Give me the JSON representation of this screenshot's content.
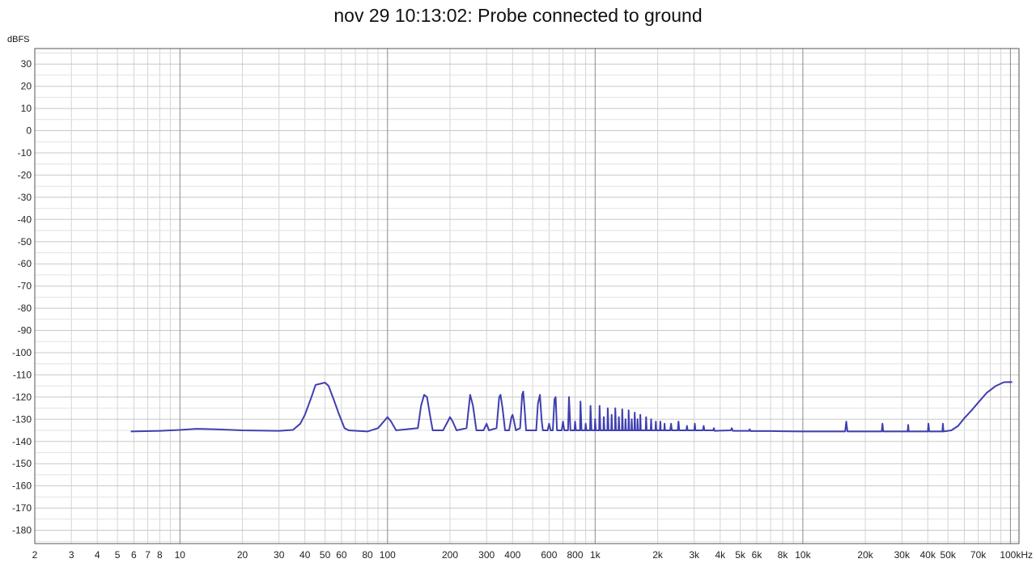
{
  "chart_data": {
    "type": "line",
    "title": "nov 29 10:13:02: Probe connected to ground",
    "ylabel": "dBFS",
    "xlabel": "",
    "x_scale": "log",
    "xlim": [
      2,
      110000
    ],
    "ylim": [
      -186,
      37
    ],
    "grid": true,
    "x_tick_labels": [
      {
        "v": 2,
        "t": "2"
      },
      {
        "v": 3,
        "t": "3"
      },
      {
        "v": 4,
        "t": "4"
      },
      {
        "v": 5,
        "t": "5"
      },
      {
        "v": 6,
        "t": "6"
      },
      {
        "v": 7,
        "t": "7"
      },
      {
        "v": 8,
        "t": "8"
      },
      {
        "v": 10,
        "t": "10"
      },
      {
        "v": 20,
        "t": "20"
      },
      {
        "v": 30,
        "t": "30"
      },
      {
        "v": 40,
        "t": "40"
      },
      {
        "v": 50,
        "t": "50"
      },
      {
        "v": 60,
        "t": "60"
      },
      {
        "v": 80,
        "t": "80"
      },
      {
        "v": 100,
        "t": "100"
      },
      {
        "v": 200,
        "t": "200"
      },
      {
        "v": 300,
        "t": "300"
      },
      {
        "v": 400,
        "t": "400"
      },
      {
        "v": 600,
        "t": "600"
      },
      {
        "v": 800,
        "t": "800"
      },
      {
        "v": 1000,
        "t": "1k"
      },
      {
        "v": 2000,
        "t": "2k"
      },
      {
        "v": 3000,
        "t": "3k"
      },
      {
        "v": 4000,
        "t": "4k"
      },
      {
        "v": 5000,
        "t": "5k"
      },
      {
        "v": 6000,
        "t": "6k"
      },
      {
        "v": 8000,
        "t": "8k"
      },
      {
        "v": 10000,
        "t": "10k"
      },
      {
        "v": 20000,
        "t": "20k"
      },
      {
        "v": 30000,
        "t": "30k"
      },
      {
        "v": 40000,
        "t": "40k"
      },
      {
        "v": 50000,
        "t": "50k"
      },
      {
        "v": 70000,
        "t": "70k"
      },
      {
        "v": 100000,
        "t": "100kHz"
      }
    ],
    "y_ticks": [
      30,
      20,
      10,
      0,
      -10,
      -20,
      -30,
      -40,
      -50,
      -60,
      -70,
      -80,
      -90,
      -100,
      -110,
      -120,
      -130,
      -140,
      -150,
      -160,
      -170,
      -180
    ],
    "series": [
      {
        "color": "#3f3fb0",
        "points": [
          [
            5.8,
            -135.5
          ],
          [
            8,
            -135.2
          ],
          [
            10,
            -134.8
          ],
          [
            12,
            -134.3
          ],
          [
            15,
            -134.5
          ],
          [
            20,
            -135
          ],
          [
            30,
            -135.2
          ],
          [
            35,
            -134.8
          ],
          [
            38,
            -132
          ],
          [
            40,
            -128
          ],
          [
            43,
            -120
          ],
          [
            45,
            -114.5
          ],
          [
            50,
            -113.5
          ],
          [
            52,
            -115
          ],
          [
            55,
            -121
          ],
          [
            58,
            -127
          ],
          [
            62,
            -134
          ],
          [
            65,
            -135
          ],
          [
            80,
            -135.5
          ],
          [
            90,
            -134
          ],
          [
            100,
            -129
          ],
          [
            104,
            -131
          ],
          [
            110,
            -135
          ],
          [
            140,
            -134
          ],
          [
            145,
            -124
          ],
          [
            150,
            -119
          ],
          [
            155,
            -120
          ],
          [
            160,
            -128
          ],
          [
            165,
            -135
          ],
          [
            185,
            -135
          ],
          [
            195,
            -131
          ],
          [
            200,
            -129
          ],
          [
            206,
            -131
          ],
          [
            215,
            -135
          ],
          [
            240,
            -134
          ],
          [
            250,
            -119
          ],
          [
            258,
            -124
          ],
          [
            268,
            -135
          ],
          [
            290,
            -135
          ],
          [
            300,
            -132
          ],
          [
            308,
            -135
          ],
          [
            335,
            -134
          ],
          [
            345,
            -120
          ],
          [
            350,
            -119
          ],
          [
            358,
            -125
          ],
          [
            368,
            -135
          ],
          [
            385,
            -135
          ],
          [
            395,
            -129
          ],
          [
            400,
            -128
          ],
          [
            405,
            -130
          ],
          [
            415,
            -135
          ],
          [
            435,
            -134
          ],
          [
            445,
            -119
          ],
          [
            450,
            -117.5
          ],
          [
            456,
            -124
          ],
          [
            465,
            -135
          ],
          [
            520,
            -135
          ],
          [
            530,
            -123
          ],
          [
            542,
            -119
          ],
          [
            552,
            -130
          ],
          [
            560,
            -135
          ],
          [
            590,
            -135
          ],
          [
            600,
            -132
          ],
          [
            610,
            -135
          ],
          [
            625,
            -135
          ],
          [
            637,
            -121
          ],
          [
            645,
            -120
          ],
          [
            655,
            -135
          ],
          [
            690,
            -135
          ],
          [
            700,
            -131
          ],
          [
            710,
            -135
          ],
          [
            740,
            -135
          ],
          [
            748,
            -120
          ],
          [
            760,
            -135
          ],
          [
            795,
            -135
          ],
          [
            800,
            -131
          ],
          [
            808,
            -135
          ],
          [
            845,
            -135
          ],
          [
            850,
            -122
          ],
          [
            860,
            -135
          ],
          [
            895,
            -135
          ],
          [
            900,
            -132
          ],
          [
            908,
            -135
          ],
          [
            945,
            -135
          ],
          [
            950,
            -124
          ],
          [
            960,
            -135
          ],
          [
            995,
            -135
          ],
          [
            1000,
            -130
          ],
          [
            1008,
            -135
          ],
          [
            1045,
            -135
          ],
          [
            1050,
            -124
          ],
          [
            1060,
            -135
          ],
          [
            1095,
            -135
          ],
          [
            1100,
            -129
          ],
          [
            1108,
            -135
          ],
          [
            1145,
            -135
          ],
          [
            1150,
            -125
          ],
          [
            1160,
            -135
          ],
          [
            1195,
            -135
          ],
          [
            1200,
            -128
          ],
          [
            1208,
            -135
          ],
          [
            1245,
            -135
          ],
          [
            1250,
            -125
          ],
          [
            1260,
            -135
          ],
          [
            1295,
            -135
          ],
          [
            1300,
            -129
          ],
          [
            1308,
            -135
          ],
          [
            1345,
            -135
          ],
          [
            1350,
            -125.5
          ],
          [
            1360,
            -135
          ],
          [
            1395,
            -135
          ],
          [
            1400,
            -130
          ],
          [
            1408,
            -135
          ],
          [
            1445,
            -135
          ],
          [
            1450,
            -126
          ],
          [
            1460,
            -135
          ],
          [
            1495,
            -135
          ],
          [
            1500,
            -130
          ],
          [
            1508,
            -135
          ],
          [
            1545,
            -135
          ],
          [
            1550,
            -127
          ],
          [
            1560,
            -135
          ],
          [
            1595,
            -135
          ],
          [
            1600,
            -130
          ],
          [
            1608,
            -135
          ],
          [
            1645,
            -135
          ],
          [
            1650,
            -128
          ],
          [
            1660,
            -135
          ],
          [
            1750,
            -135
          ],
          [
            1760,
            -129
          ],
          [
            1770,
            -135
          ],
          [
            1850,
            -135
          ],
          [
            1860,
            -130
          ],
          [
            1870,
            -135
          ],
          [
            1950,
            -135
          ],
          [
            1960,
            -131
          ],
          [
            1970,
            -135
          ],
          [
            2050,
            -135
          ],
          [
            2060,
            -131
          ],
          [
            2070,
            -135
          ],
          [
            2150,
            -135
          ],
          [
            2160,
            -132
          ],
          [
            2170,
            -135
          ],
          [
            2300,
            -135
          ],
          [
            2320,
            -132
          ],
          [
            2340,
            -135
          ],
          [
            2500,
            -135
          ],
          [
            2520,
            -131
          ],
          [
            2540,
            -135
          ],
          [
            2750,
            -135
          ],
          [
            2770,
            -133
          ],
          [
            2790,
            -135
          ],
          [
            3000,
            -135
          ],
          [
            3020,
            -132
          ],
          [
            3040,
            -135
          ],
          [
            3300,
            -135
          ],
          [
            3330,
            -133
          ],
          [
            3360,
            -135
          ],
          [
            3700,
            -135
          ],
          [
            3730,
            -134
          ],
          [
            3760,
            -135.2
          ],
          [
            4500,
            -135
          ],
          [
            4550,
            -134
          ],
          [
            4600,
            -135.2
          ],
          [
            5500,
            -135.2
          ],
          [
            5550,
            -134.5
          ],
          [
            5600,
            -135.3
          ],
          [
            7000,
            -135.3
          ],
          [
            8000,
            -135.4
          ],
          [
            10000,
            -135.5
          ],
          [
            15000,
            -135.5
          ],
          [
            16000,
            -135.5
          ],
          [
            16200,
            -131
          ],
          [
            16400,
            -135.5
          ],
          [
            24000,
            -135.5
          ],
          [
            24200,
            -132
          ],
          [
            24400,
            -135.5
          ],
          [
            32000,
            -135.5
          ],
          [
            32200,
            -132.5
          ],
          [
            32400,
            -135.5
          ],
          [
            40000,
            -135.5
          ],
          [
            40300,
            -132
          ],
          [
            40600,
            -135.5
          ],
          [
            47000,
            -135.5
          ],
          [
            47300,
            -132
          ],
          [
            47600,
            -135.5
          ],
          [
            52000,
            -135
          ],
          [
            56000,
            -133
          ],
          [
            60000,
            -129.5
          ],
          [
            65000,
            -126
          ],
          [
            70000,
            -122.5
          ],
          [
            77000,
            -118
          ],
          [
            85000,
            -115
          ],
          [
            93000,
            -113.3
          ],
          [
            100000,
            -113.2
          ],
          [
            102000,
            -113.3
          ]
        ]
      }
    ]
  }
}
